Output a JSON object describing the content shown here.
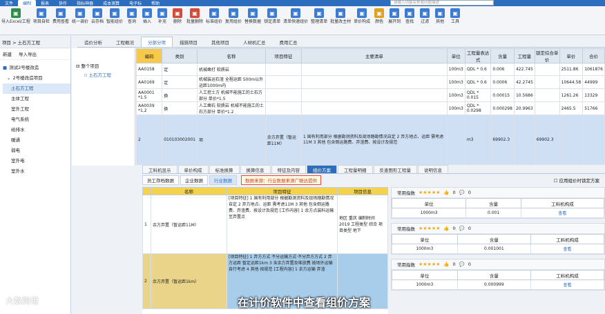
{
  "menubar": {
    "items": [
      "文件",
      "编制",
      "报表",
      "协作",
      "指标神器",
      "成本测算",
      "电子标",
      "帮助"
    ],
    "active_index": 1
  },
  "search": {
    "placeholder": "请输入功能名称或问题描述"
  },
  "ribbon": {
    "buttons": [
      {
        "label": "导入Excel/工程",
        "icon": "import-icon",
        "color": "#2f8f46"
      },
      {
        "label": "项目自检",
        "icon": "check-icon",
        "color": "#3b7bd4"
      },
      {
        "label": "费用查看",
        "icon": "cost-icon",
        "color": "#3b7bd4"
      },
      {
        "label": "统一调价",
        "icon": "adjust-icon",
        "color": "#3b7bd4"
      },
      {
        "label": "云存档",
        "icon": "cloud-icon",
        "color": "#3b7bd4"
      },
      {
        "label": "智能组价",
        "icon": "smart-icon",
        "color": "#3b7bd4"
      },
      {
        "label": "查询",
        "icon": "query-icon",
        "color": "#3b7bd4"
      },
      {
        "label": "插入",
        "icon": "insert-icon",
        "color": "#3b7bd4"
      },
      {
        "label": "补充",
        "icon": "supplement-icon",
        "color": "#3b7bd4"
      },
      {
        "label": "删除",
        "icon": "delete-icon",
        "color": "#d24b3a"
      },
      {
        "label": "批量删除",
        "icon": "batch-delete-icon",
        "color": "#d24b3a"
      },
      {
        "label": "标准组价",
        "icon": "standard-icon",
        "color": "#3b7bd4"
      },
      {
        "label": "复用组价",
        "icon": "reuse-icon",
        "color": "#3b7bd4"
      },
      {
        "label": "替换数据",
        "icon": "replace-icon",
        "color": "#3b7bd4"
      },
      {
        "label": "锁定清单",
        "icon": "lock-icon",
        "color": "#3b7bd4"
      },
      {
        "label": "清单快速组价",
        "icon": "fast-icon",
        "color": "#3b7bd4"
      },
      {
        "label": "整理清单",
        "icon": "sort-icon",
        "color": "#3b7bd4"
      },
      {
        "label": "批量改主材",
        "icon": "material-icon",
        "color": "#3b7bd4"
      },
      {
        "label": "单价构成",
        "icon": "price-icon",
        "color": "#3b7bd4"
      },
      {
        "label": "颜色",
        "icon": "color-icon",
        "color": "#e0a020"
      },
      {
        "label": "展开到",
        "icon": "expand-icon",
        "color": "#3b7bd4"
      },
      {
        "label": "查找",
        "icon": "find-icon",
        "color": "#3b7bd4"
      },
      {
        "label": "过滤",
        "icon": "filter-icon",
        "color": "#3b7bd4"
      },
      {
        "label": "其他",
        "icon": "more-icon",
        "color": "#3b7bd4"
      },
      {
        "label": "工具",
        "icon": "tool-icon",
        "color": "#3b7bd4"
      }
    ]
  },
  "left": {
    "header": "项目 > 土石方工程",
    "toolbar": [
      "新建",
      "导入导出"
    ],
    "project": "测试2号楼改造",
    "items": [
      "2号楼改造项目",
      "土石方工程",
      "主体工程",
      "室外工程",
      "电气系统",
      "给排水",
      "暖通",
      "弱电",
      "室外电",
      "室外水"
    ],
    "selected": "土石方工程"
  },
  "top_tabs": {
    "items": [
      "造价分析",
      "工程概况",
      "分部分项",
      "措施项目",
      "其他项目",
      "人材机汇总",
      "费用汇总"
    ],
    "active": "分部分项"
  },
  "midtree": {
    "root": "整个项目",
    "child": "土石方工程"
  },
  "grid": {
    "headers": [
      "编码",
      "类别",
      "名称",
      "项目特征",
      "主要清单",
      "单位",
      "工程量表达式",
      "含量",
      "工程量",
      "锁定综合单价",
      "单价",
      "合价"
    ],
    "rows": [
      {
        "code": "AA0158",
        "type": "定",
        "name": "机械凿打 软质岩",
        "feature": "",
        "main": "",
        "unit": "100m3",
        "expr": "QDL * 0.6",
        "content": "0.006",
        "qty": "422.745",
        "lock": "",
        "price": "2511.86",
        "total": "1061876"
      },
      {
        "code": "AA0169",
        "type": "定",
        "name": "机械装运石渣 全程运距 500m以外 运距1000m内",
        "feature": "",
        "main": "",
        "unit": "100m3",
        "expr": "QDL * 0.6",
        "content": "0.0006",
        "qty": "42.2745",
        "lock": "",
        "price": "10644.58",
        "total": "44999"
      },
      {
        "code": "AA0001 *1.5",
        "type": "换",
        "name": "人工挖土方 机械不能施工的土石方部分 单价*1.5",
        "feature": "",
        "main": "",
        "unit": "100m3",
        "expr": "QDL * 0.015",
        "content": "0.00015",
        "qty": "10.5686",
        "lock": "",
        "price": "1261.26",
        "total": "13329"
      },
      {
        "code": "AA0039 *1.2",
        "type": "换",
        "name": "人工凿石 软质岩 机械不能施工的土石方部分 单价*1.2",
        "feature": "",
        "main": "",
        "unit": "100m3",
        "expr": "QDL * 0.0298",
        "content": "0.000298",
        "qty": "20.9963",
        "lock": "",
        "price": "2465.5",
        "total": "51766"
      }
    ],
    "sel_row": {
      "index": "2",
      "code": "010103002001",
      "type": "项",
      "name": "余方弃置（暂运距11M）",
      "feature": "1 国有利用部分 根据勘测资料及现场踏勘情况自定 2 弃方地点、运距 需考虑11M 3 其他 包含倒运路费、弃渣费、按设计及规范",
      "unit": "m3",
      "expr": "69902.3",
      "qty": "69902.3"
    }
  },
  "bottom_tabs": {
    "items": [
      "工料机显示",
      "单价构成",
      "标准换算",
      "换算信息",
      "特征及内容",
      "组价方案",
      "工程量明细",
      "反查图形工程量",
      "说明信息"
    ],
    "active": "组价方案"
  },
  "sub_tabs": {
    "items": [
      "员工存档数据",
      "企业数据",
      "行业数据"
    ],
    "active": "行业数据",
    "source_notice": "数据来源：行业数据来源广联达提供",
    "checkbox_label": "应用组价时锁定方案"
  },
  "plan": {
    "headers": [
      "",
      "名称",
      "项目特征",
      "项目信息"
    ],
    "rows": [
      {
        "no": "1",
        "name": "余方弃置（暂运距11M）",
        "feature": "[项目特征] 1 国有利用部分 根据勘测资料及现场踏勘情况自定 2 弃方地点、运距 需考虑11M 3 其他 包含倒运路费、弃渣费、按设计及规范 [工作内容] 1 余方点装料运输至弃置点",
        "info": "地区 重庆 编制时间 2019 工程类型 综合 项目类型 地下"
      },
      {
        "no": "2",
        "name": "余方弃置（暂运距1km）",
        "feature": "[项目特征] 1 弃方方式 不分运输方式·不分弃方方式 2 弃方运距 暂定运距1km 3 含余方弃置及堆放费 按场外运输自行考虑 4 其他 按规范 [工程内容] 1 余方运输 弃渣",
        "info": ""
      }
    ]
  },
  "cards": [
    {
      "title": "常用指数",
      "stars": "★★★★★",
      "likes": "0",
      "comments": "0",
      "unit": "1000m3",
      "content": "0.001",
      "link": "查看"
    },
    {
      "title": "常用指数",
      "stars": "★★★★★",
      "likes": "0",
      "comments": "0",
      "unit": "1000m3",
      "content": "0.001001",
      "link": "查看"
    },
    {
      "title": "常用指数",
      "stars": "★★★★★",
      "likes": "0",
      "comments": "0",
      "unit": "1000m3",
      "content": "0.000999",
      "link": "查看"
    }
  ],
  "card_headers": {
    "unit": "单位",
    "content": "含量",
    "struct": "工料机构成"
  },
  "caption": "在计价软件中查看组价方案",
  "logo": "大数跨境"
}
